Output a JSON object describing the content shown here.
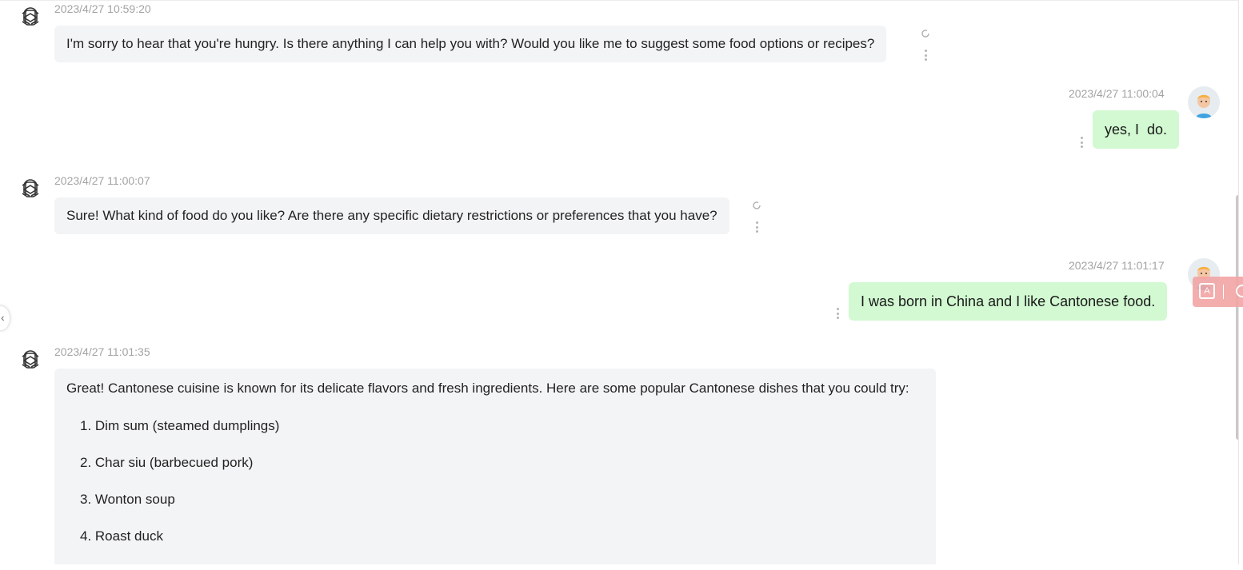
{
  "messages": [
    {
      "role": "assistant",
      "timestamp": "2023/4/27 10:59:20",
      "text": "I'm sorry to hear that you're hungry. Is there anything I can help you with? Would you like me to suggest some food options or recipes?"
    },
    {
      "role": "user",
      "timestamp": "2023/4/27 11:00:04",
      "text": "yes, I  do."
    },
    {
      "role": "assistant",
      "timestamp": "2023/4/27 11:00:07",
      "text": "Sure! What kind of food do you like? Are there any specific dietary restrictions or preferences that you have?"
    },
    {
      "role": "user",
      "timestamp": "2023/4/27 11:01:17",
      "text": "I was born in China and I like Cantonese food."
    },
    {
      "role": "assistant",
      "timestamp": "2023/4/27 11:01:35",
      "intro": "Great! Cantonese cuisine is known for its delicate flavors and fresh ingredients. Here are some popular Cantonese dishes that you could try:",
      "items": [
        "1. Dim sum (steamed dumplings)",
        "2. Char siu (barbecued pork)",
        "3. Wonton soup",
        "4. Roast duck"
      ]
    }
  ],
  "icons": {
    "assistant_avatar": "openai-logo-icon",
    "user_avatar": "cartoon-boy-avatar",
    "regenerate": "refresh-icon",
    "more": "more-vertical-icon",
    "ai_tool": "ai-translate-icon",
    "ai_tool_label": "A"
  },
  "colors": {
    "assistant_bubble": "#f3f4f6",
    "user_bubble": "#d2f9d1",
    "timestamp": "#a3a3a3"
  }
}
